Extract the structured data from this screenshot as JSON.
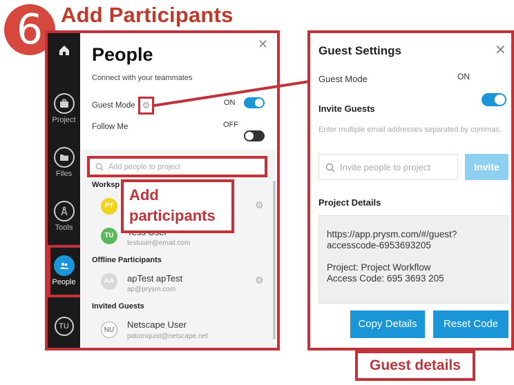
{
  "header": {
    "step_number": "6",
    "title": "Add Participants"
  },
  "rail": {
    "items": [
      {
        "label": "",
        "icon": "home-icon"
      },
      {
        "label": "Project",
        "icon": "briefcase-icon"
      },
      {
        "label": "Files",
        "icon": "folder-icon"
      },
      {
        "label": "Tools",
        "icon": "compass-icon"
      },
      {
        "label": "People",
        "icon": "people-icon"
      },
      {
        "label": "TU",
        "icon": "user-avatar"
      }
    ]
  },
  "people": {
    "title": "People",
    "subtitle": "Connect with your teammates",
    "guest_mode_label": "Guest Mode",
    "guest_mode_state": "ON",
    "follow_me_label": "Follow Me",
    "follow_me_state": "OFF",
    "search_placeholder": "Add people to project",
    "workspace_section": "Worksp",
    "workspace_people": [
      {
        "initials": "PT",
        "name": "",
        "email": "",
        "color": "#f2d21b"
      },
      {
        "initials": "TU",
        "name": "Tess User",
        "email": "testuser@email.com",
        "color": "#5cb85c"
      }
    ],
    "offline_section": "Offline Participants",
    "offline_people": [
      {
        "initials": "AA",
        "name": "apTest apTest",
        "email": "ap@prysm.com",
        "color": "#d8d8d8"
      }
    ],
    "invited_section": "Invited Guests",
    "invited_people": [
      {
        "initials": "NU",
        "name": "Netscape User",
        "email": "patornquist@netscape.net",
        "color": "#ffffff"
      }
    ]
  },
  "callouts": {
    "add_participants": "Add participants",
    "guest_details": "Guest details"
  },
  "guest_settings": {
    "title": "Guest Settings",
    "guest_mode_label": "Guest Mode",
    "guest_mode_state": "ON",
    "invite_heading": "Invite Guests",
    "invite_hint": "Enter multiple email addresses separated by commas.",
    "invite_placeholder": "Invite people to project",
    "invite_button": "Invite",
    "details_heading": "Project Details",
    "details_url_1": "https://app.prysm.com/#/guest?",
    "details_url_2": "accesscode-6953693205",
    "details_project": "Project: Project Workflow",
    "details_access": "Access Code: 695 3693 205",
    "copy_button": "Copy Details",
    "reset_button": "Reset Code"
  },
  "colors": {
    "accent": "#1a95d8",
    "annotation_red": "#c1333a",
    "rail_bg": "#1a1a1a"
  }
}
